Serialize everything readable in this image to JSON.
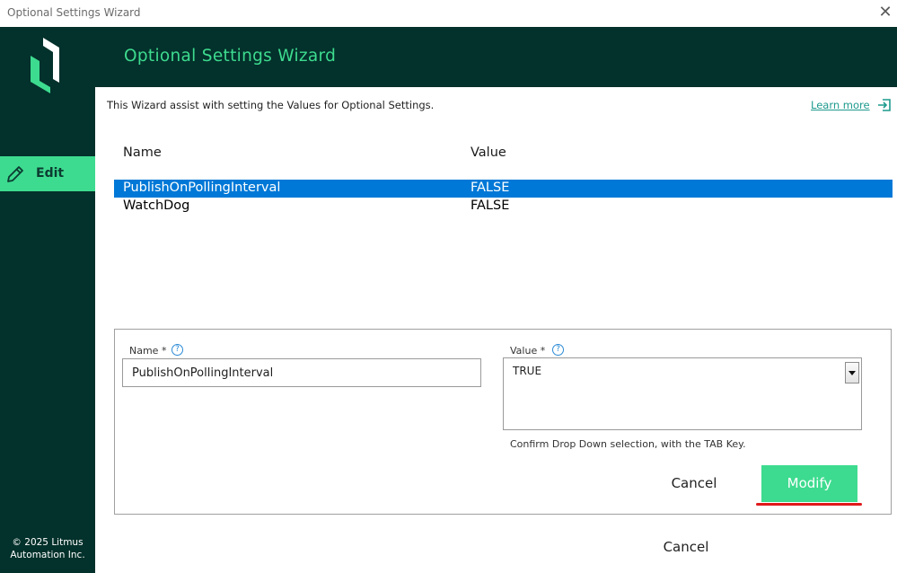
{
  "window": {
    "title": "Optional Settings Wizard",
    "close_glyph": "✕"
  },
  "sidebar": {
    "logo_icon": "litmus-logo-icon",
    "nav": [
      {
        "label": "Edit",
        "icon": "pencil-icon",
        "active": true
      }
    ],
    "copyright_line1": "© 2025 Litmus",
    "copyright_line2": "Automation Inc."
  },
  "header": {
    "title": "Optional Settings Wizard"
  },
  "intro": {
    "text": "This Wizard assist with setting the Values for Optional Settings.",
    "learn_more": "Learn more",
    "learn_more_icon": "external-link-icon"
  },
  "table": {
    "columns": [
      "Name",
      "Value"
    ],
    "rows": [
      {
        "name": "PublishOnPollingInterval",
        "value": "FALSE",
        "selected": true
      },
      {
        "name": "WatchDog",
        "value": "FALSE",
        "selected": false
      }
    ]
  },
  "form": {
    "name_label": "Name *",
    "name_value": "PublishOnPollingInterval",
    "value_label": "Value *",
    "value_selected": "TRUE",
    "help_glyph": "?",
    "hint": "Confirm Drop Down selection, with the TAB Key.",
    "cancel_label": "Cancel",
    "modify_label": "Modify"
  },
  "footer": {
    "cancel_label": "Cancel"
  },
  "colors": {
    "dark": "#03312b",
    "accent": "#3ddb8f",
    "selection": "#0078d7",
    "link": "#1d9a8d",
    "highlight": "#e0191b"
  }
}
